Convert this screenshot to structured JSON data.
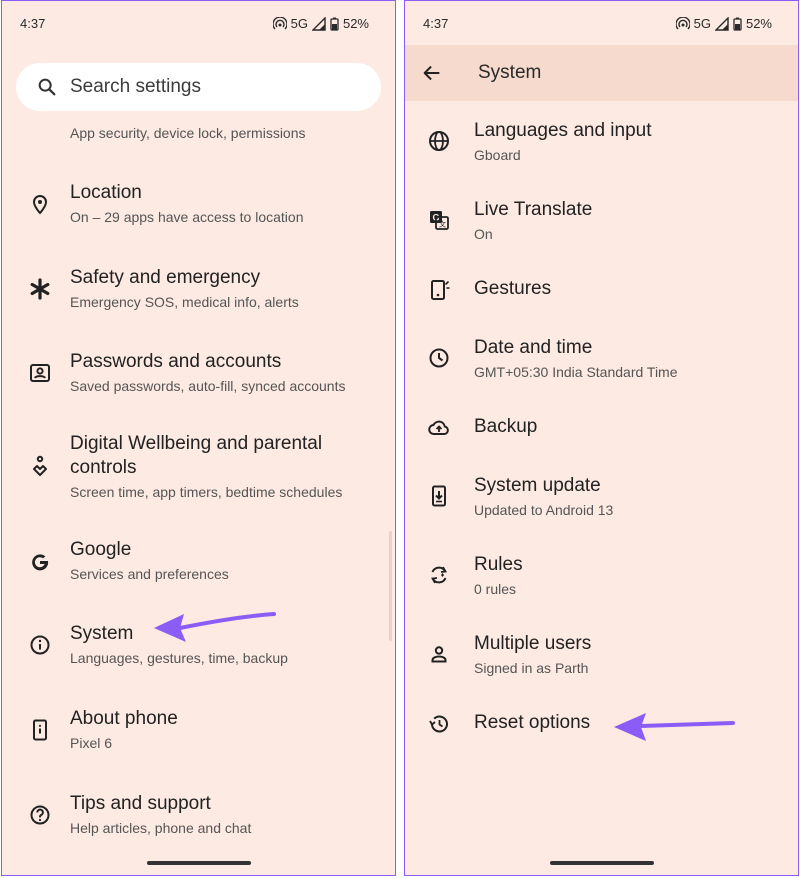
{
  "colors": {
    "background": "#fdeae2",
    "accent": "#8b5cf6",
    "app_bar": "#f5dacd"
  },
  "left": {
    "status": {
      "time": "4:37",
      "network": "5G",
      "battery": "52%"
    },
    "search": {
      "placeholder": "Search settings",
      "icon": "search-icon"
    },
    "partial_item_subtitle": "App security, device lock, permissions",
    "items": [
      {
        "title": "Location",
        "subtitle": "On – 29 apps have access to location",
        "icon": "location-pin-icon"
      },
      {
        "title": "Safety and emergency",
        "subtitle": "Emergency SOS, medical info, alerts",
        "icon": "asterisk-icon"
      },
      {
        "title": "Passwords and accounts",
        "subtitle": "Saved passwords, auto-fill, synced accounts",
        "icon": "account-box-icon"
      },
      {
        "title_line1": "Digital Wellbeing and parental",
        "title_line2": "controls",
        "subtitle": "Screen time, app timers, bedtime schedules",
        "icon": "wellbeing-icon"
      },
      {
        "title": "Google",
        "subtitle": "Services and preferences",
        "icon": "google-icon"
      },
      {
        "title": "System",
        "subtitle": "Languages, gestures, time, backup",
        "icon": "info-icon"
      },
      {
        "title": "About phone",
        "subtitle": "Pixel 6",
        "icon": "phone-info-icon"
      },
      {
        "title": "Tips and support",
        "subtitle": "Help articles, phone and chat",
        "icon": "help-icon"
      }
    ]
  },
  "right": {
    "status": {
      "time": "4:37",
      "network": "5G",
      "battery": "52%"
    },
    "app_bar": {
      "title": "System",
      "back_icon": "back-arrow-icon"
    },
    "items": [
      {
        "title": "Languages and input",
        "subtitle": "Gboard",
        "icon": "globe-icon"
      },
      {
        "title": "Live Translate",
        "subtitle": "On",
        "icon": "translate-icon"
      },
      {
        "title": "Gestures",
        "subtitle": "",
        "icon": "gestures-icon"
      },
      {
        "title": "Date and time",
        "subtitle": "GMT+05:30 India Standard Time",
        "icon": "clock-icon"
      },
      {
        "title": "Backup",
        "subtitle": "",
        "icon": "cloud-upload-icon"
      },
      {
        "title": "System update",
        "subtitle": "Updated to Android 13",
        "icon": "system-update-icon"
      },
      {
        "title": "Rules",
        "subtitle": "0 rules",
        "icon": "rules-icon"
      },
      {
        "title": "Multiple users",
        "subtitle": "Signed in as Parth",
        "icon": "person-icon"
      },
      {
        "title": "Reset options",
        "subtitle": "",
        "icon": "history-icon"
      }
    ]
  }
}
